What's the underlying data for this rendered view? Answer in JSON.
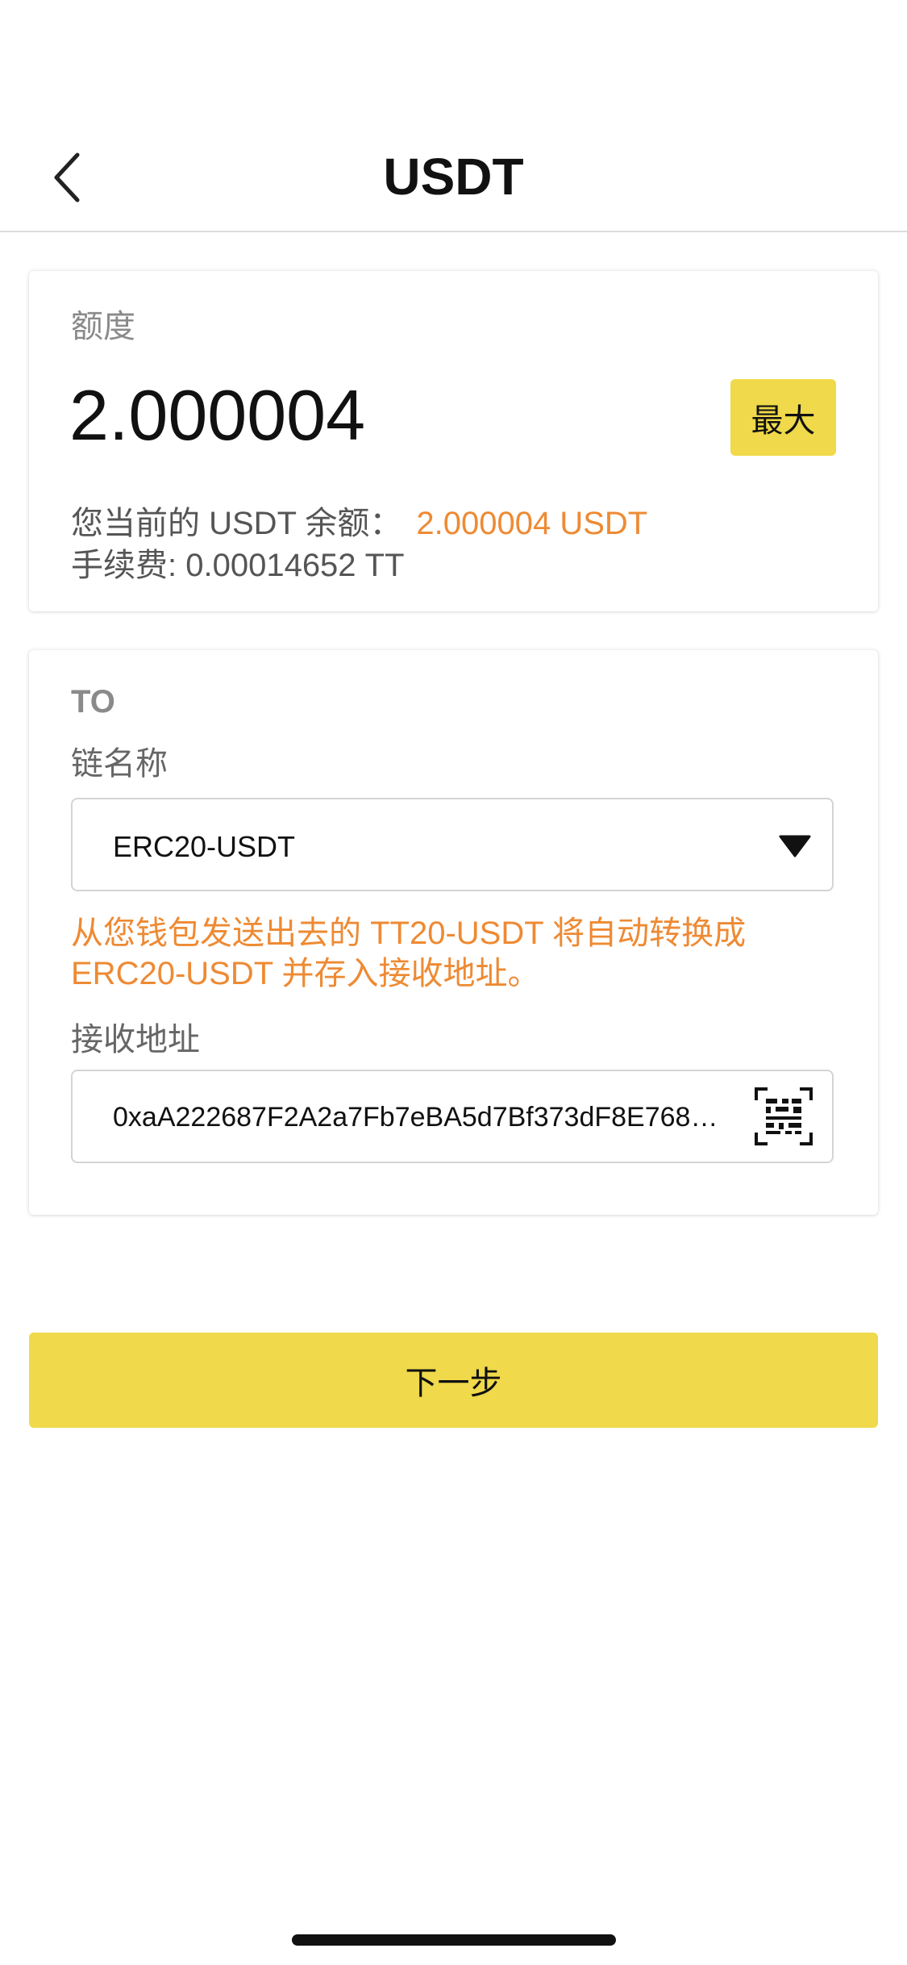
{
  "header": {
    "title": "USDT"
  },
  "amount_card": {
    "label": "额度",
    "amount": "2.000004",
    "max_button": "最大",
    "balance_label": "您当前的 USDT 余额：",
    "balance_value": "2.000004 USDT",
    "fee_text": "手续费: 0.00014652 TT"
  },
  "to_card": {
    "to_label": "TO",
    "chain_label": "链名称",
    "chain_value": "ERC20-USDT",
    "warning": "从您钱包发送出去的 TT20-USDT 将自动转换成 ERC20-USDT 并存入接收地址。",
    "address_label": "接收地址",
    "address_value": "0xaA222687F2A2a7Fb7eBA5d7Bf373dF8E768…"
  },
  "footer": {
    "next_button": "下一步"
  },
  "icons": {
    "back": "back-chevron-icon",
    "dropdown": "caret-down-icon",
    "scan": "qr-scan-icon"
  },
  "colors": {
    "accent_yellow": "#f0d94a",
    "highlight_orange": "#ee8a33"
  }
}
